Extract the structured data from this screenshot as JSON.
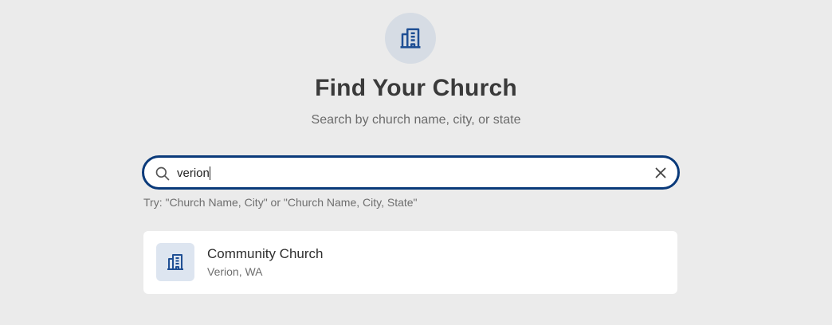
{
  "header": {
    "icon": "building-icon",
    "title": "Find Your Church",
    "subtitle": "Search by church name, city, or state"
  },
  "search": {
    "value": "verion",
    "icon": "search-icon",
    "clear_icon": "close-icon",
    "hint": "Try: \"Church Name, City\" or \"Church Name, City, State\""
  },
  "results": [
    {
      "icon": "building-icon",
      "name": "Community Church",
      "location": "Verion, WA"
    }
  ],
  "colors": {
    "background": "#ebebeb",
    "accent": "#0a3a7a",
    "icon_blue": "#1f4f94",
    "hero_circle": "#d6dce4",
    "result_icon_bg": "#dde5f0"
  }
}
